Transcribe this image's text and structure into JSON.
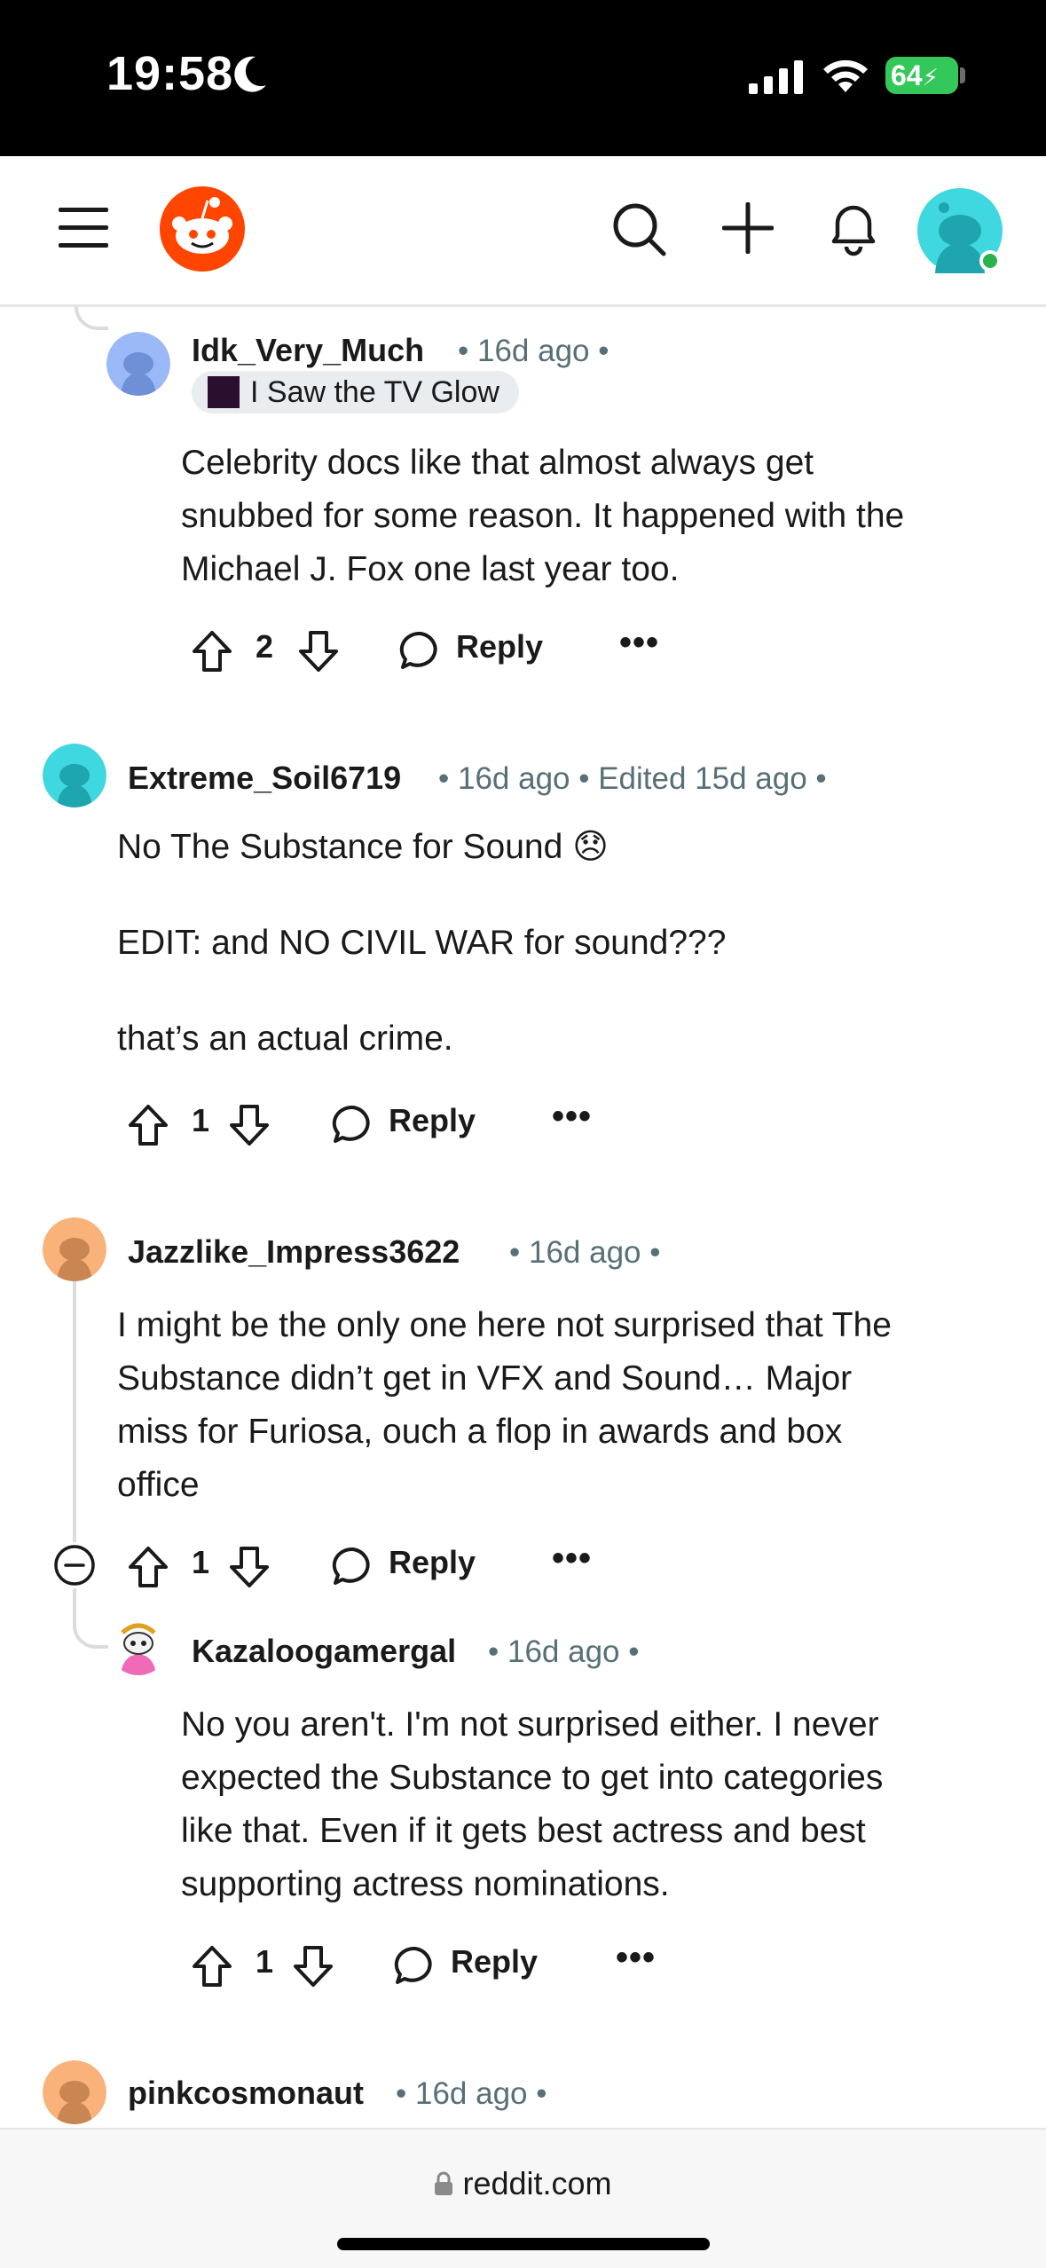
{
  "status_bar": {
    "time": "19:58",
    "battery": "64"
  },
  "comments": [
    {
      "username": "Idk_Very_Much",
      "meta": "• 16d ago •",
      "flair": "I Saw the TV Glow",
      "body": "Celebrity docs like that almost always get\nsnubbed for some reason. It happened with the\nMichael J. Fox one last year too.",
      "votes": "2",
      "reply": "Reply",
      "more": "•••"
    },
    {
      "username": "Extreme_Soil6719",
      "meta": "• 16d ago • Edited 15d ago •",
      "body": "No The Substance for Sound 😞\n\nEDIT: and NO CIVIL WAR for sound???\n\nthat’s an actual crime.",
      "votes": "1",
      "reply": "Reply",
      "more": "•••"
    },
    {
      "username": "Jazzlike_Impress3622",
      "meta": "• 16d ago •",
      "body": "I might be the only one here not surprised that The\nSubstance didn’t get in VFX and Sound… Major\nmiss for Furiosa, ouch a flop in awards and box\noffice",
      "votes": "1",
      "reply": "Reply",
      "more": "•••"
    },
    {
      "username": "Kazaloogamergal",
      "meta": "• 16d ago •",
      "body": "No you aren't. I'm not surprised either. I never\nexpected the Substance to get into categories\nlike that. Even if it gets best actress and best\nsupporting actress nominations.",
      "votes": "1",
      "reply": "Reply",
      "more": "•••"
    },
    {
      "username": "pinkcosmonaut",
      "meta": "• 16d ago •"
    }
  ],
  "browser": {
    "url": "reddit.com"
  },
  "colors": {
    "reddit_orange": "#ff4500",
    "avatar_teal": "#3fd8e0",
    "online": "#2bb24c",
    "meta_gray": "#576f76"
  }
}
